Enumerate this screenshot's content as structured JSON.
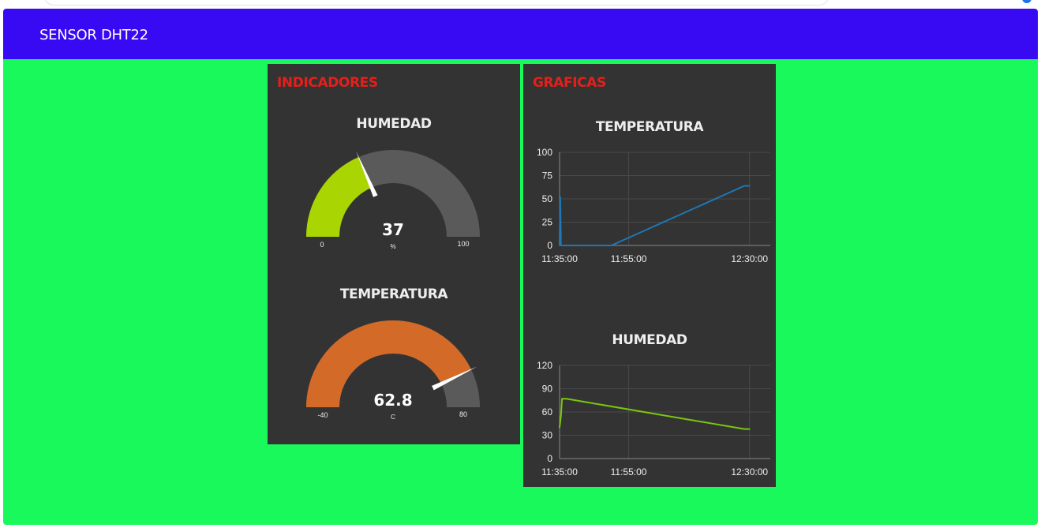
{
  "header": {
    "title": "SENSOR DHT22"
  },
  "indicadores": {
    "title": "INDICADORES",
    "humidity_gauge": {
      "label": "HUMEDAD",
      "value": "37",
      "units": "%",
      "min": "0",
      "max": "100",
      "min_num": 0,
      "max_num": 100,
      "value_num": 37,
      "color": "#a9d502",
      "track_color": "#5a5a5a",
      "needle_color": "#ffffff"
    },
    "temperature_gauge": {
      "label": "TEMPERATURA",
      "value": "62.8",
      "units": "C",
      "min": "-40",
      "max": "80",
      "min_num": -40,
      "max_num": 80,
      "value_num": 62.8,
      "color": "#d36a28",
      "track_color": "#5a5a5a",
      "needle_color": "#ffffff"
    }
  },
  "graficas": {
    "title": "GRAFICAS",
    "chart_data": [
      {
        "type": "line",
        "title": "TEMPERATURA",
        "xlabel": "",
        "ylabel": "",
        "x_ticks": [
          "11:35:00",
          "11:55:00",
          "12:30:00"
        ],
        "x_tick_minutes": [
          0,
          20,
          55
        ],
        "xlim_minutes": [
          0,
          61
        ],
        "y_ticks": [
          "0",
          "25",
          "50",
          "75",
          "100"
        ],
        "ylim": [
          0,
          100
        ],
        "grid": true,
        "color": "#1f77b4",
        "series": [
          {
            "x_minutes": [
              0,
              0.2,
              0.4,
              0.6,
              15,
              53.5,
              55
            ],
            "values": [
              0,
              52,
              0,
              0,
              0,
              64,
              64
            ]
          }
        ]
      },
      {
        "type": "line",
        "title": "HUMEDAD",
        "xlabel": "",
        "ylabel": "",
        "x_ticks": [
          "11:35:00",
          "11:55:00",
          "12:30:00"
        ],
        "x_tick_minutes": [
          0,
          20,
          55
        ],
        "xlim_minutes": [
          0,
          61
        ],
        "y_ticks": [
          "0",
          "30",
          "60",
          "90",
          "120"
        ],
        "ylim": [
          0,
          120
        ],
        "grid": true,
        "color": "#7ac70c",
        "series": [
          {
            "x_minutes": [
              0,
              0.4,
              0.7,
              2,
              53.5,
              55
            ],
            "values": [
              40,
              55,
              77,
              77,
              38,
              38
            ]
          }
        ]
      }
    ]
  }
}
